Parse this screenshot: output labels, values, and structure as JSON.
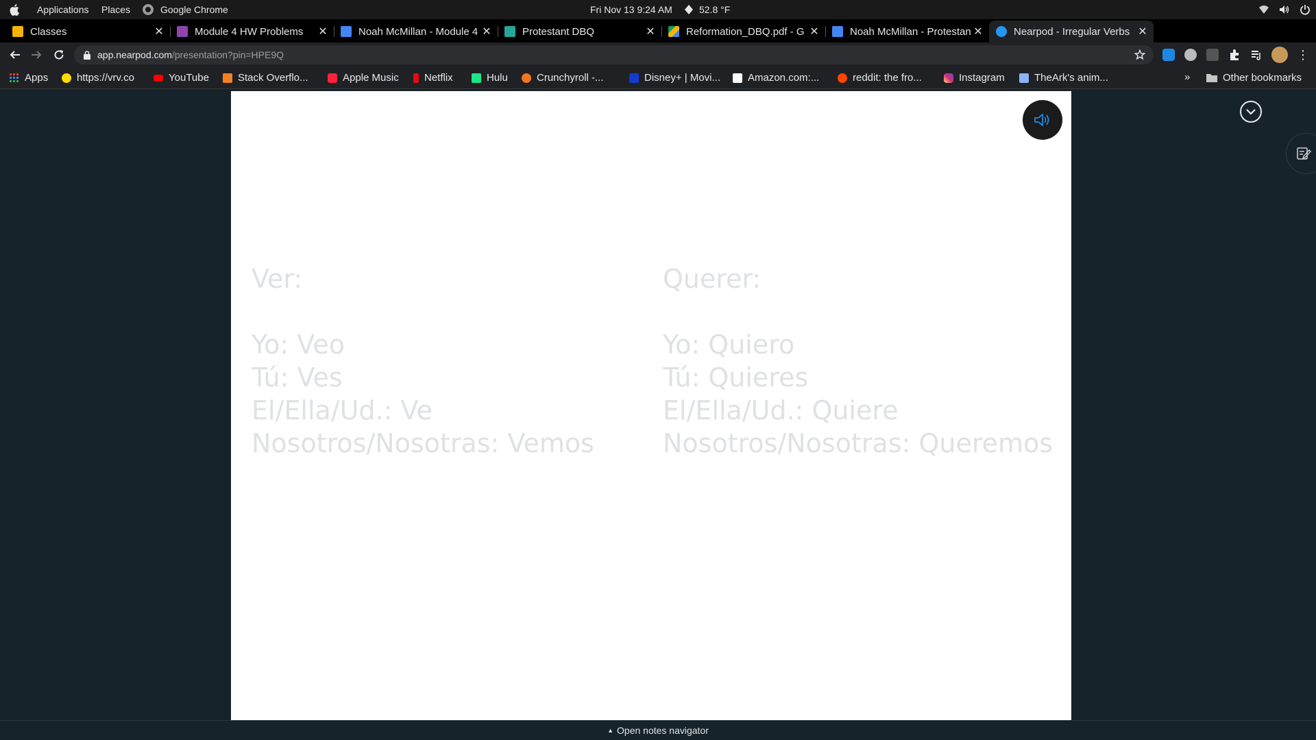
{
  "os_bar": {
    "applications": "Applications",
    "places": "Places",
    "app_name": "Google Chrome",
    "datetime": "Fri Nov 13   9:24 AM",
    "weather": "52.8 °F"
  },
  "tabs": [
    {
      "title": "Classes",
      "color": "#f4b400"
    },
    {
      "title": "Module 4 HW Problems",
      "color": "#8e44ad"
    },
    {
      "title": "Noah McMillan - Module 4",
      "color": "#4285f4"
    },
    {
      "title": "Protestant DBQ",
      "color": "#26a69a"
    },
    {
      "title": "Reformation_DBQ.pdf - G",
      "color": "#0f9d58"
    },
    {
      "title": "Noah McMillan - Protestant",
      "color": "#4285f4"
    },
    {
      "title": "Nearpod - Irregular Verbs",
      "color": "#2196f3"
    }
  ],
  "address": {
    "host": "app.nearpod.com",
    "path": "/presentation?pin=HPE9Q"
  },
  "bookmarks": [
    {
      "label": "Apps",
      "icon": "apps-grid-icon",
      "color": "#e94235"
    },
    {
      "label": "https://vrv.co",
      "icon": "vrv-icon",
      "color": "#ffdd00"
    },
    {
      "label": "YouTube",
      "icon": "youtube-icon",
      "color": "#ff0000"
    },
    {
      "label": "Stack Overflo...",
      "icon": "stackoverflow-icon",
      "color": "#f48024"
    },
    {
      "label": "Apple Music",
      "icon": "apple-music-icon",
      "color": "#fa233b"
    },
    {
      "label": "Netflix",
      "icon": "netflix-icon",
      "color": "#e50914"
    },
    {
      "label": "Hulu",
      "icon": "hulu-icon",
      "color": "#1ce783"
    },
    {
      "label": "Crunchyroll -...",
      "icon": "crunchyroll-icon",
      "color": "#f47521"
    },
    {
      "label": "Disney+ | Movi...",
      "icon": "disney-plus-icon",
      "color": "#113ccf"
    },
    {
      "label": "Amazon.com:...",
      "icon": "amazon-icon",
      "color": "#ffffff"
    },
    {
      "label": "reddit: the fro...",
      "icon": "reddit-icon",
      "color": "#ff4500"
    },
    {
      "label": "Instagram",
      "icon": "instagram-icon",
      "color": "#d62976"
    },
    {
      "label": "TheArk's anim...",
      "icon": "theark-icon",
      "color": "#8ab4f8"
    }
  ],
  "bookmarks_more": "»",
  "other_bookmarks": "Other bookmarks",
  "slide": {
    "left": {
      "header": "Ver:",
      "lines": [
        "Yo: Veo",
        "Tú: Ves",
        "El/Ella/Ud.: Ve",
        "Nosotros/Nosotras: Vemos"
      ]
    },
    "right": {
      "header": "Querer:",
      "lines": [
        "Yo: Quiero",
        "Tú: Quieres",
        "El/Ella/Ud.: Quiere",
        "Nosotros/Nosotras: Queremos"
      ]
    }
  },
  "notes_bar": {
    "arrow": "▲",
    "label": "Open notes navigator"
  }
}
